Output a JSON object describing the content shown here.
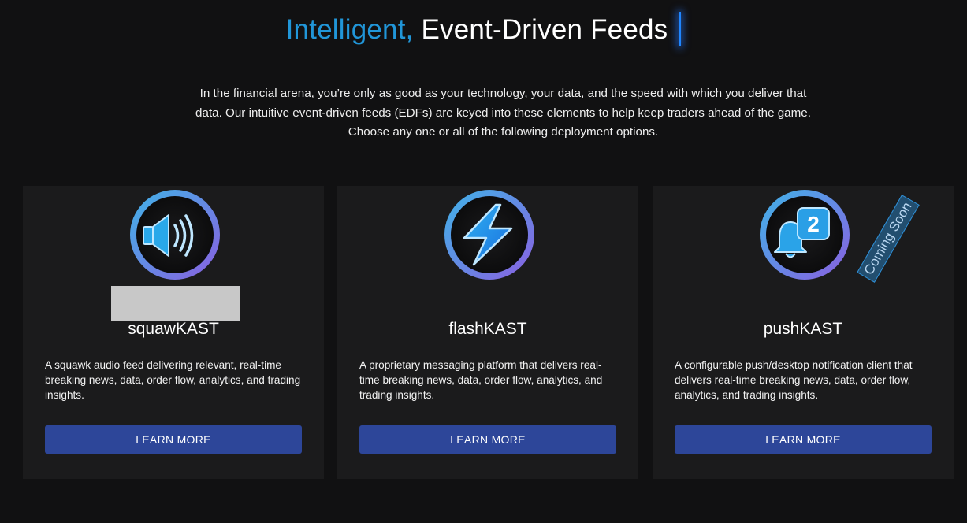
{
  "header": {
    "title_accent": "Intelligent,",
    "title_rest": "Event-Driven Feeds",
    "intro": "In the financial arena, you’re only as good as your technology, your data, and the speed with which you deliver that data. Our intuitive event-driven feeds (EDFs) are keyed into these elements to help keep traders ahead of the game. Choose any one or all of the following deployment options."
  },
  "cards": [
    {
      "icon": "speaker-icon",
      "title": "squawKAST",
      "description": "A squawk audio feed delivering relevant, real-time breaking news, data, order flow, analytics, and trading insights.",
      "button_label": "LEARN MORE"
    },
    {
      "icon": "lightning-icon",
      "title": "flashKAST",
      "description": "A proprietary messaging platform that delivers real-time breaking news, data, order flow, analytics, and trading insights.",
      "button_label": "LEARN MORE"
    },
    {
      "icon": "notification-bell-icon",
      "title": "pushKAST",
      "description": "A configurable push/desktop notification client that delivers real-time breaking news, data, order flow, analytics, and trading insights.",
      "button_label": "LEARN MORE",
      "badge": "Coming Soon",
      "notification_count": "2"
    }
  ],
  "colors": {
    "background": "#111112",
    "card": "#1b1b1c",
    "accent": "#2196d8",
    "button": "#2d4699",
    "ring_start": "#3fb4e8",
    "ring_end": "#8a5fe0"
  }
}
